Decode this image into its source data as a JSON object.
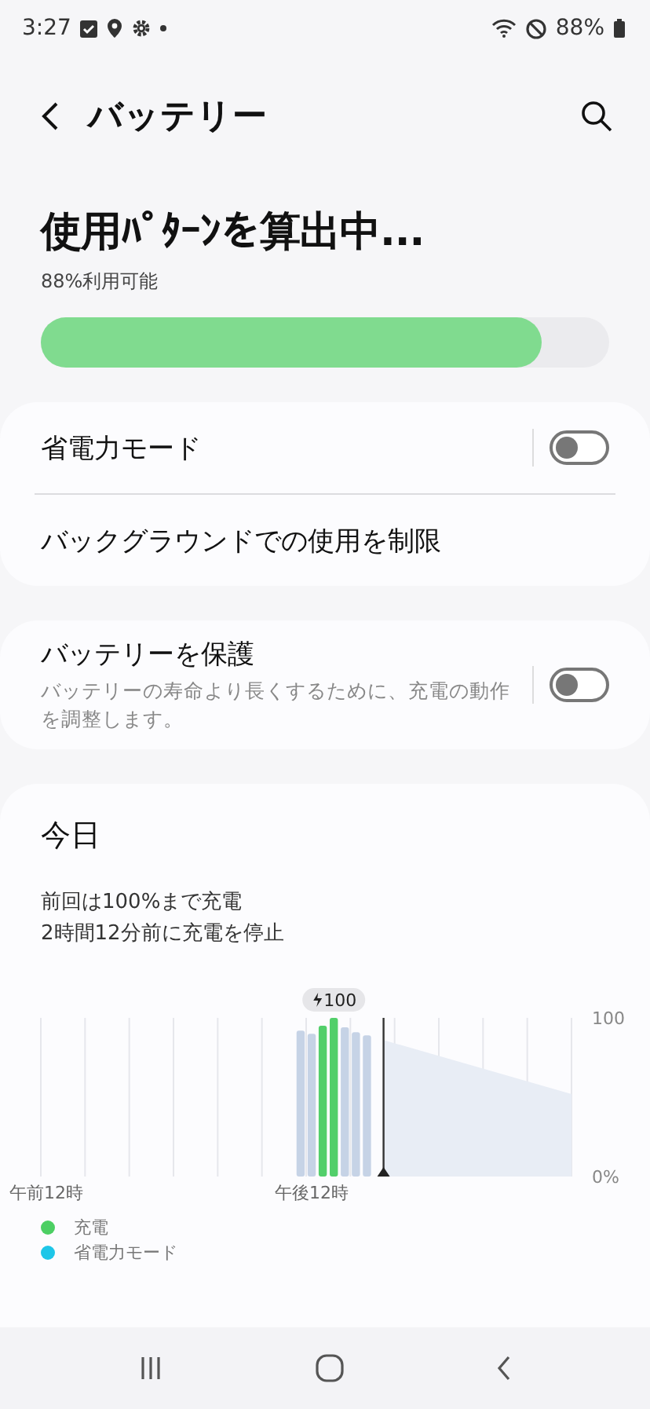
{
  "status_bar": {
    "time": "3:27",
    "battery": "88%"
  },
  "header": {
    "title": "バッテリー"
  },
  "summary": {
    "title": "使用ﾊﾟﾀｰﾝを算出中...",
    "subtitle": "88%利用可能",
    "level": 0.88
  },
  "settings_cards": [
    {
      "rows": [
        {
          "kind": "toggle",
          "label": "省電力モード",
          "on": false
        },
        {
          "kind": "link",
          "label": "バックグラウンドでの使用を制限"
        }
      ]
    },
    {
      "rows": [
        {
          "kind": "toggle",
          "label": "バッテリーを保護",
          "description": "バッテリーの寿命より長くするために、充電の動作を調整します。",
          "on": false
        }
      ]
    }
  ],
  "today": {
    "title": "今日",
    "lines": [
      "前回は100%まで充電",
      "2時間12分前に充電を停止"
    ],
    "charge_badge": "100",
    "chart_data": {
      "type": "bar",
      "categories": [
        "午前12時",
        null,
        null,
        null,
        null,
        null,
        null,
        null,
        null,
        null,
        null,
        null,
        null,
        null,
        null,
        null,
        null,
        null,
        null,
        null,
        null,
        null,
        null,
        null,
        "午後12時",
        null,
        null,
        null,
        null,
        null,
        null,
        null,
        null,
        null,
        null,
        null,
        null,
        null,
        null,
        null,
        null,
        null,
        null,
        null,
        null,
        null,
        null,
        null
      ],
      "ylim": [
        0,
        100
      ],
      "yticks": [
        {
          "value": 100,
          "label": "100"
        },
        {
          "value": 0,
          "label": "0%"
        }
      ],
      "series": [
        {
          "color": "#c6d3e6",
          "values": [
            null,
            null,
            null,
            null,
            null,
            null,
            null,
            null,
            null,
            null,
            null,
            null,
            null,
            null,
            null,
            null,
            null,
            null,
            null,
            null,
            null,
            null,
            null,
            92,
            90,
            null,
            null,
            94,
            91,
            89,
            null,
            null,
            null,
            null,
            null,
            null,
            null,
            null,
            null,
            null,
            null,
            null,
            null,
            null,
            null,
            null,
            null,
            null
          ]
        },
        {
          "color": "#52cf6a",
          "values": [
            null,
            null,
            null,
            null,
            null,
            null,
            null,
            null,
            null,
            null,
            null,
            null,
            null,
            null,
            null,
            null,
            null,
            null,
            null,
            null,
            null,
            null,
            null,
            null,
            null,
            95,
            100,
            null,
            null,
            null,
            null,
            null,
            null,
            null,
            null,
            null,
            null,
            null,
            null,
            null,
            null,
            null,
            null,
            null,
            null,
            null,
            null,
            null
          ]
        }
      ]
    },
    "legend": [
      {
        "label": "充電",
        "color": "#4ccf63"
      },
      {
        "label": "省電力モード",
        "color": "#1ec6e8"
      }
    ]
  }
}
